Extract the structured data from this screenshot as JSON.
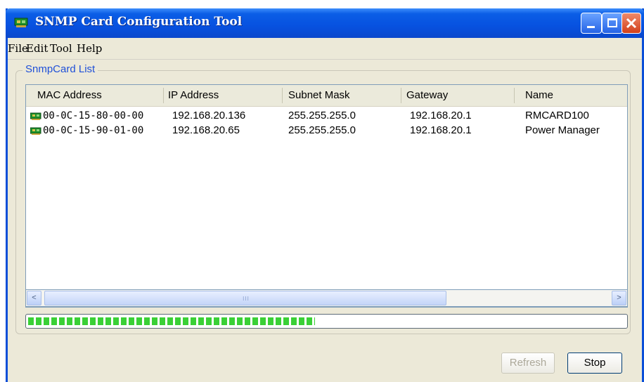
{
  "window": {
    "title": "SNMP Card Configuration Tool",
    "accent_color": "#0b5ee6",
    "icons": {
      "app": "network-card-icon",
      "minimize": "minimize-icon",
      "maximize": "maximize-icon",
      "close": "close-icon"
    }
  },
  "menu": {
    "items": [
      "File",
      "Edit",
      "Tool",
      "Help"
    ]
  },
  "group": {
    "label": "SnmpCard List"
  },
  "table": {
    "columns": [
      "MAC Address",
      "IP Address",
      "Subnet Mask",
      "Gateway",
      "Name"
    ],
    "rows": [
      {
        "mac": "00-0C-15-80-00-00",
        "ip": "192.168.20.136",
        "mask": "255.255.255.0",
        "gateway": "192.168.20.1",
        "name": "RMCARD100"
      },
      {
        "mac": "00-0C-15-90-01-00",
        "ip": "192.168.20.65",
        "mask": "255.255.255.0",
        "gateway": "192.168.20.1",
        "name": "Power Manager"
      }
    ],
    "row_icon": "network-card-icon"
  },
  "scrollbar": {
    "left_arrow": "<",
    "right_arrow": ">",
    "grip": "III"
  },
  "progress": {
    "fraction": 0.48,
    "color": "#3ad036"
  },
  "buttons": {
    "refresh": "Refresh",
    "stop": "Stop",
    "refresh_enabled": false
  }
}
